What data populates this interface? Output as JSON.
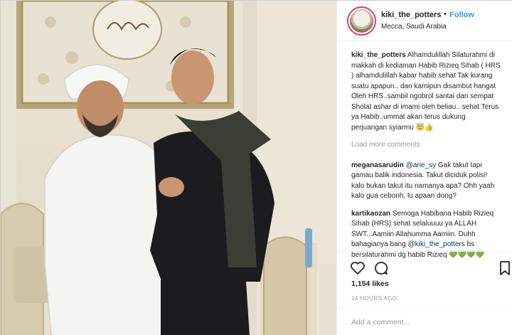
{
  "post": {
    "username": "kiki_the_potters",
    "separator": "•",
    "follow_label": "Follow",
    "location": "Mecca, Saudi Arabia"
  },
  "comments": [
    {
      "user": "kiki_the_potters",
      "text": " Alhamdulillah Silaturahmi di makkah di kediaman Habib Rizieq Sihab ( HRS ) alhamdulillah kabar habib sehat Tak kurang suatu apapun.. dan kamipun disambut hangat Oleh HRS..sambil ngobrol santai dan sempat Sholat ashar di imami oleh beliau.. sehat Terus ya Habib..ummat akan terus dukung perjuangan syiarmu 😇👍"
    },
    {
      "user": "meganasarudin",
      "mention": " @arie_sy",
      "text": " Gak takut tapi gamau balik indonesia. Takut diciduk polisi! kalo bukan takut itu namanya apa? Ohh yaah kalo gua cebonh, lu apaan dong?"
    },
    {
      "user": "kartikaozan",
      "text": " Semoga Habibana Habib Rizieq Sihab (HRS) sehat selaluuuu ya ALLAH SWT...Aamiin Allahumma Aamiin. Duhh bahagianya bang ",
      "mention": "@kiki_the_potters",
      "text2": " bs bersilaturahmi dg habib Rizieq 💚💚💚💚"
    }
  ],
  "load_more_label": "Load more comments",
  "likes_label": "1,154 likes",
  "timestamp": "14 HOURS AGO",
  "add_comment_placeholder": "Add a comment...",
  "icons": {
    "like": "heart-outline-icon",
    "comment": "speech-bubble-icon",
    "save": "bookmark-icon"
  },
  "colors": {
    "accent": "#3897f0",
    "mention": "#003569",
    "muted": "#999999"
  }
}
